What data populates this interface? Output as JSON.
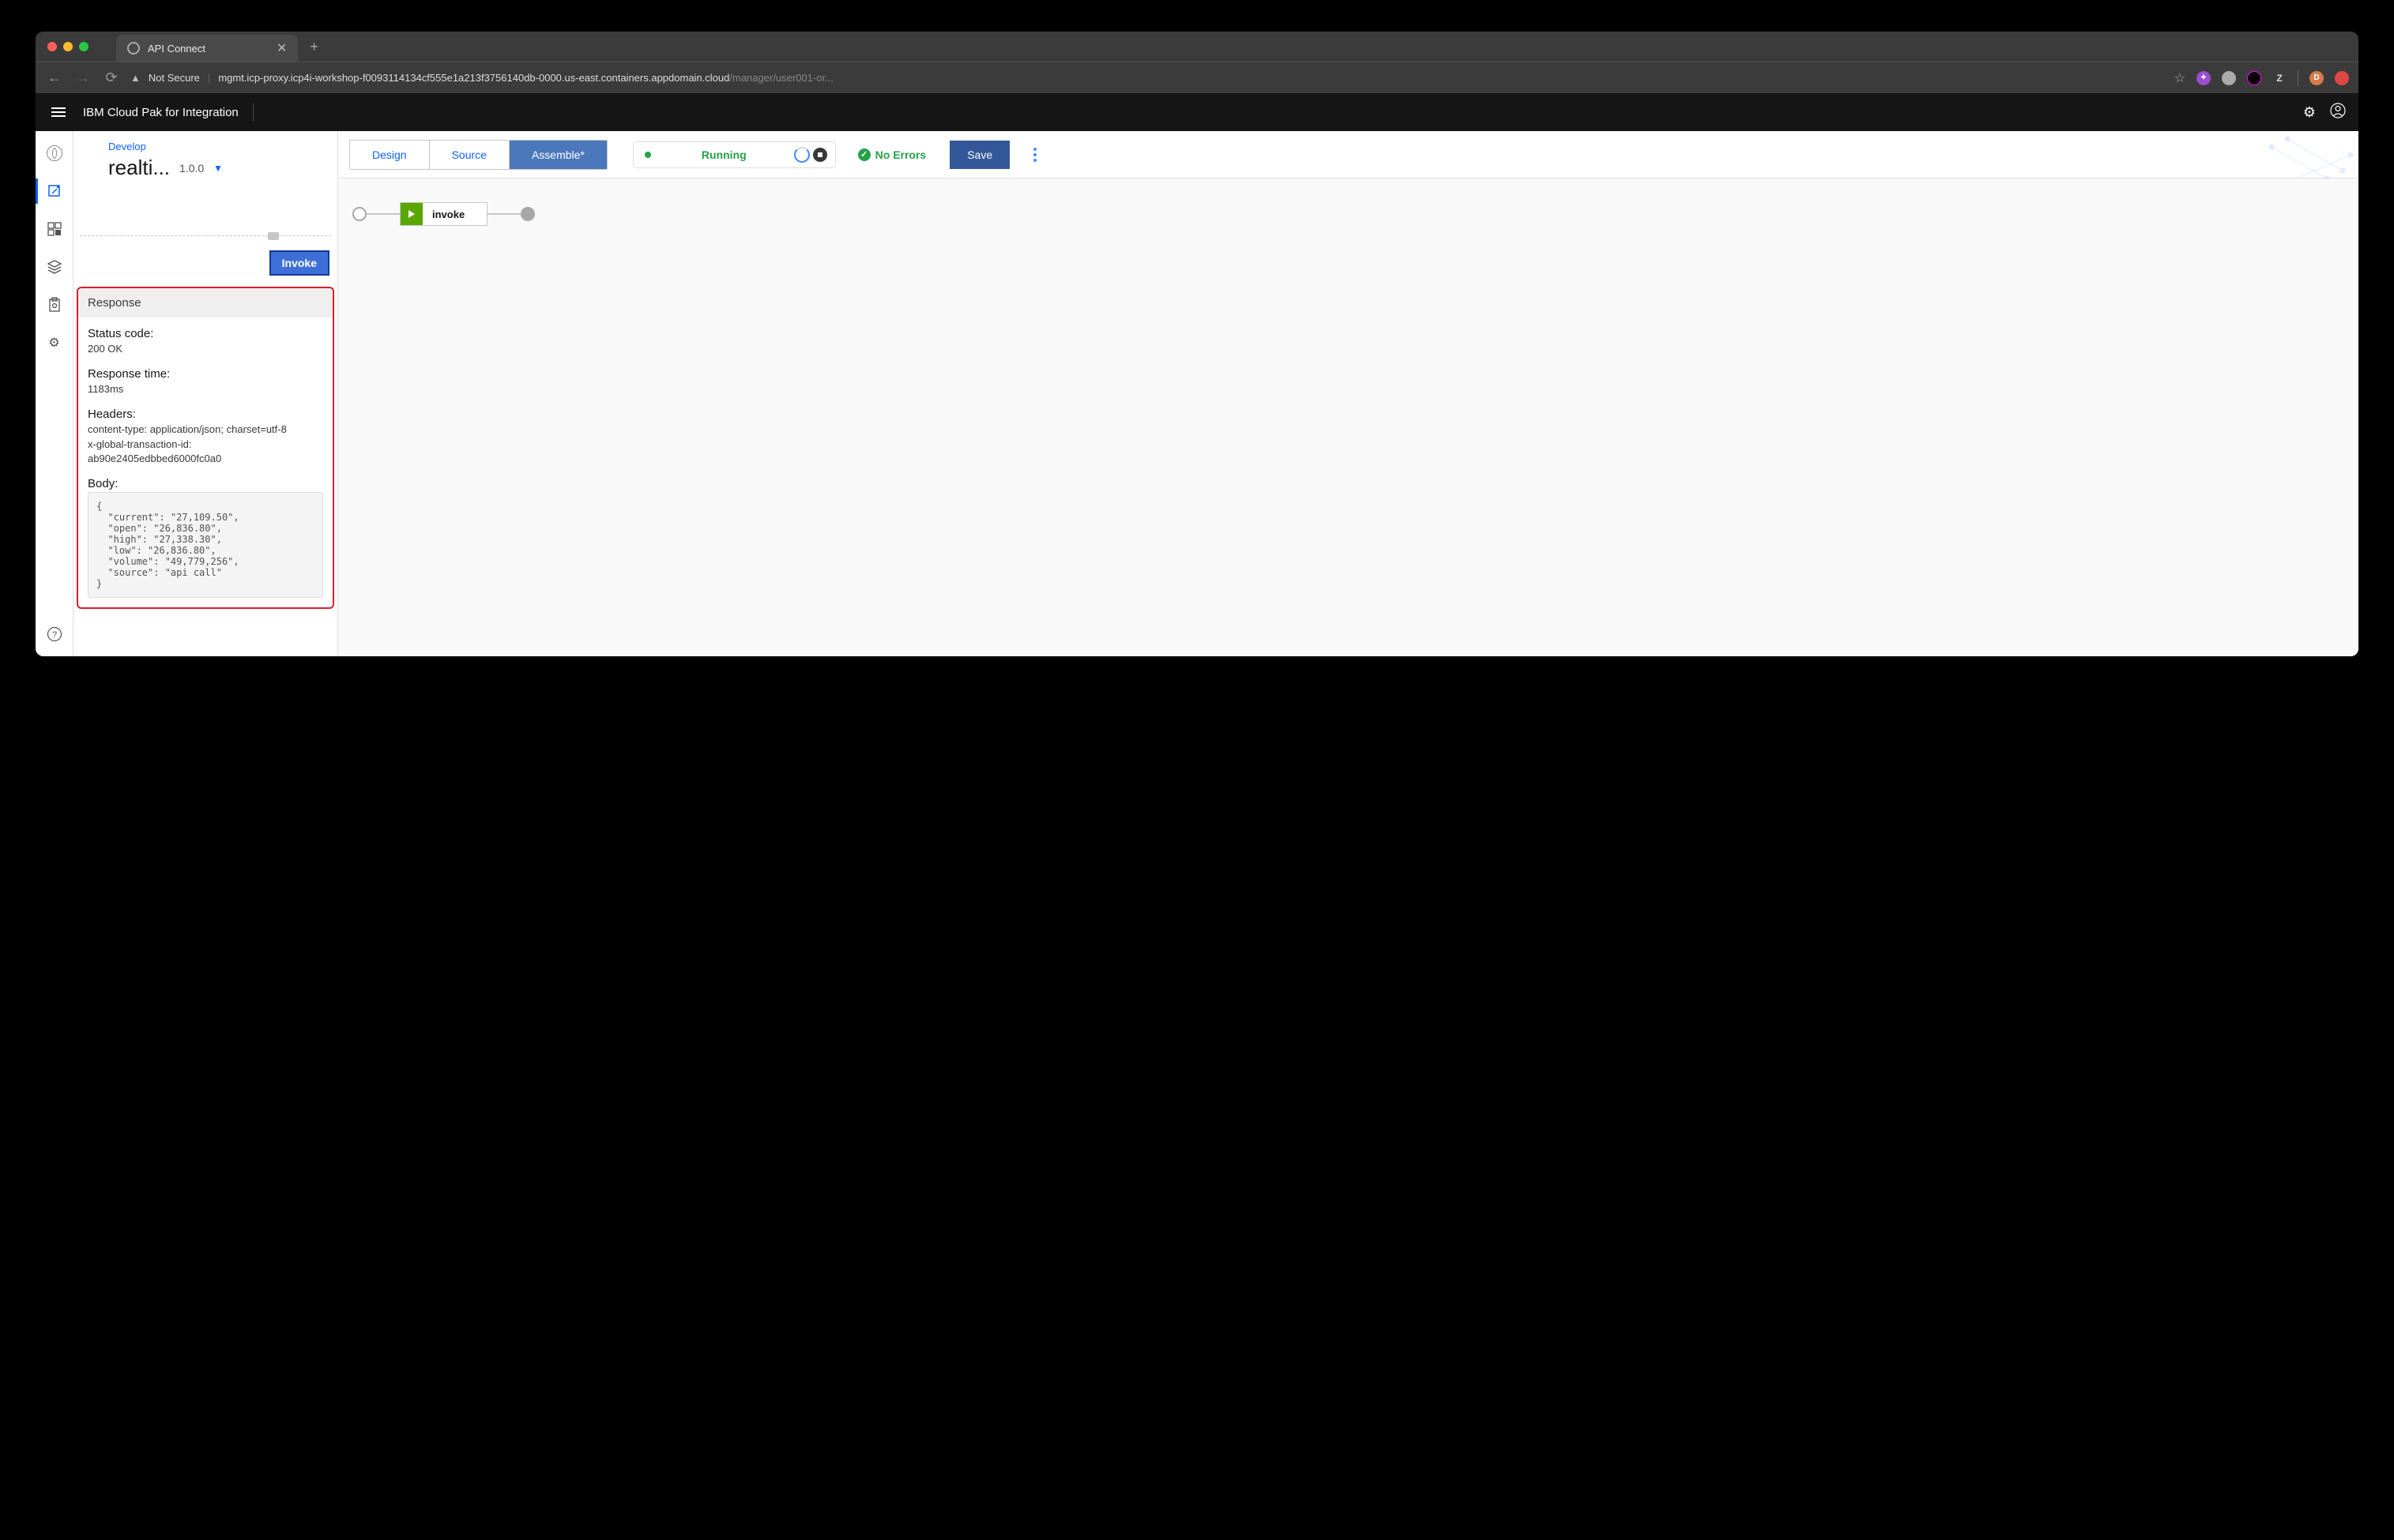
{
  "browser": {
    "tab_title": "API Connect",
    "not_secure": "Not Secure",
    "url_host": "mgmt.icp-proxy.icp4i-workshop-f0093114134cf555e1a213f3756140db-0000.us-east.containers.appdomain.cloud",
    "url_path": "/manager/user001-or...",
    "ext_z": "Z",
    "ext_d": "D"
  },
  "appbar": {
    "name": "IBM Cloud Pak for Integration"
  },
  "panel": {
    "crumb": "Develop",
    "title": "realtime",
    "title_display": "realti...",
    "version": "1.0.0",
    "invoke_label": "Invoke"
  },
  "tabs": {
    "design": "Design",
    "source": "Source",
    "assemble": "Assemble*"
  },
  "status": {
    "running": "Running",
    "no_errors": "No Errors",
    "save": "Save"
  },
  "flow": {
    "node_label": "invoke"
  },
  "response": {
    "header": "Response",
    "status_label": "Status code:",
    "status_value": "200 OK",
    "time_label": "Response time:",
    "time_value": "1183ms",
    "headers_label": "Headers:",
    "header1": "content-type: application/json; charset=utf-8",
    "header2": "x-global-transaction-id: ab90e2405edbbed6000fc0a0",
    "body_label": "Body:",
    "body_code": "{\n  \"current\": \"27,109.50\",\n  \"open\": \"26,836.80\",\n  \"high\": \"27,338.30\",\n  \"low\": \"26,836.80\",\n  \"volume\": \"49,779,256\",\n  \"source\": \"api call\"\n}"
  }
}
